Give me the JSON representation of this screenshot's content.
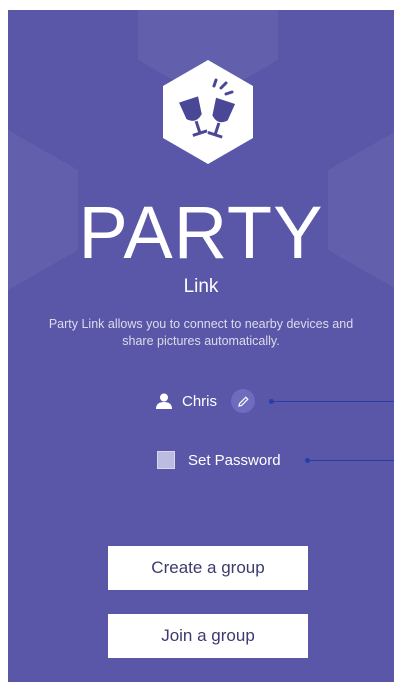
{
  "app": {
    "title": "PARTY",
    "subtitle": "Link",
    "description": "Party Link allows you to connect to nearby devices and share pictures automatically."
  },
  "user": {
    "name": "Chris",
    "icon": "user-icon",
    "edit_icon": "pencil-icon"
  },
  "password": {
    "label": "Set Password",
    "checked": false
  },
  "actions": {
    "create_label": "Create a group",
    "join_label": "Join a group"
  },
  "colors": {
    "background": "#5a57a8",
    "button": "#ffffff",
    "button_text": "#3c3a6e",
    "callout": "#2a3da6"
  }
}
